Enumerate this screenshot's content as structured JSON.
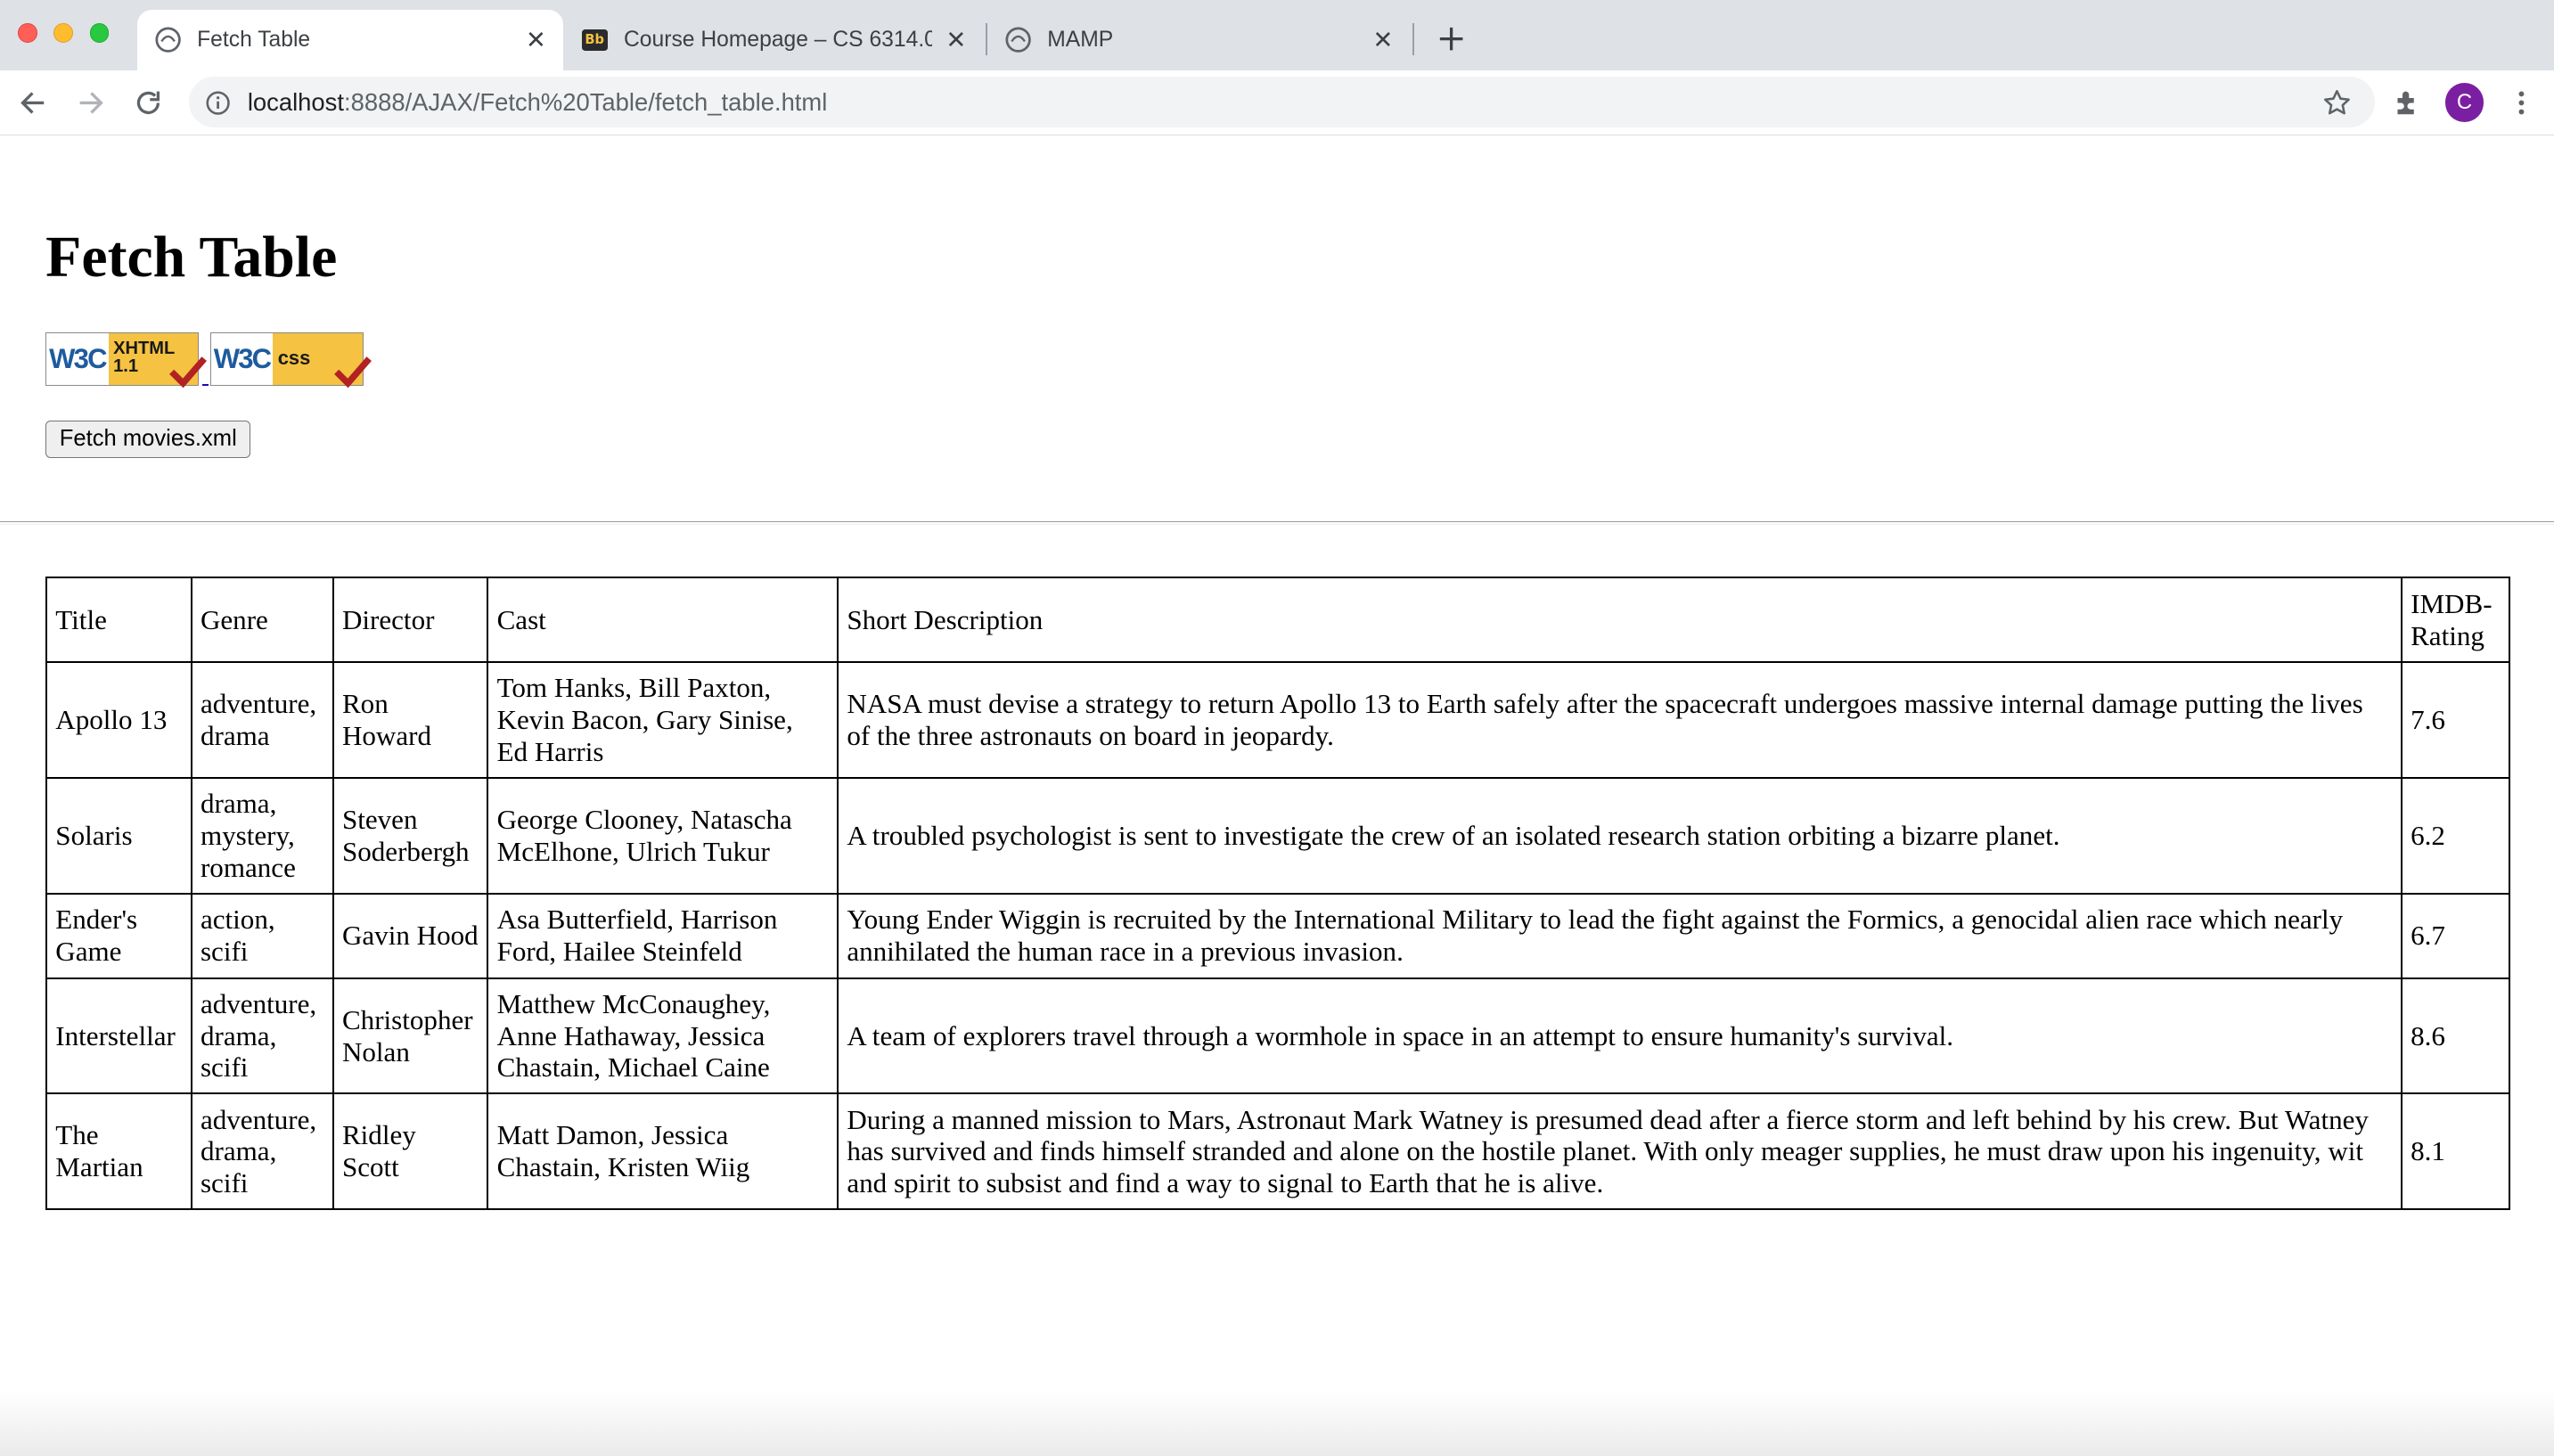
{
  "browser": {
    "tabs": [
      {
        "title": "Fetch Table",
        "favicon": "globe-icon",
        "active": true
      },
      {
        "title": "Course Homepage – CS 6314.0",
        "favicon": "blackboard-icon",
        "active": false
      },
      {
        "title": "MAMP",
        "favicon": "globe-icon",
        "active": false
      }
    ],
    "url_host": "localhost",
    "url_path": ":8888/AJAX/Fetch%20Table/fetch_table.html",
    "profile_initial": "C",
    "profile_color": "#7b1fa2"
  },
  "page": {
    "heading": "Fetch Table",
    "badges": [
      {
        "logo": "W3C",
        "kind": "XHTML",
        "version": "1.1"
      },
      {
        "logo": "W3C",
        "kind": "css",
        "version": ""
      }
    ],
    "fetch_button": "Fetch movies.xml"
  },
  "table": {
    "headers": [
      "Title",
      "Genre",
      "Director",
      "Cast",
      "Short Description",
      "IMDB-Rating"
    ],
    "rows": [
      {
        "title": "Apollo 13",
        "genre": "adventure, drama",
        "director": "Ron Howard",
        "cast": "Tom Hanks, Bill Paxton, Kevin Bacon, Gary Sinise, Ed Harris",
        "description": "NASA must devise a strategy to return Apollo 13 to Earth safely after the spacecraft undergoes massive internal damage putting the lives of the three astronauts on board in jeopardy.",
        "rating": "7.6"
      },
      {
        "title": "Solaris",
        "genre": "drama, mystery, romance",
        "director": "Steven Soderbergh",
        "cast": "George Clooney, Natascha McElhone, Ulrich Tukur",
        "description": "A troubled psychologist is sent to investigate the crew of an isolated research station orbiting a bizarre planet.",
        "rating": "6.2"
      },
      {
        "title": "Ender's Game",
        "genre": "action, scifi",
        "director": "Gavin Hood",
        "cast": "Asa Butterfield, Harrison Ford, Hailee Steinfeld",
        "description": "Young Ender Wiggin is recruited by the International Military to lead the fight against the Formics, a genocidal alien race which nearly annihilated the human race in a previous invasion.",
        "rating": "6.7"
      },
      {
        "title": "Interstellar",
        "genre": "adventure, drama, scifi",
        "director": "Christopher Nolan",
        "cast": "Matthew McConaughey, Anne Hathaway, Jessica Chastain, Michael Caine",
        "description": "A team of explorers travel through a wormhole in space in an attempt to ensure humanity's survival.",
        "rating": "8.6"
      },
      {
        "title": "The Martian",
        "genre": "adventure, drama, scifi",
        "director": "Ridley Scott",
        "cast": "Matt Damon, Jessica Chastain, Kristen Wiig",
        "description": "During a manned mission to Mars, Astronaut Mark Watney is presumed dead after a fierce storm and left behind by his crew. But Watney has survived and finds himself stranded and alone on the hostile planet. With only meager supplies, he must draw upon his ingenuity, wit and spirit to subsist and find a way to signal to Earth that he is alive.",
        "rating": "8.1"
      }
    ]
  }
}
